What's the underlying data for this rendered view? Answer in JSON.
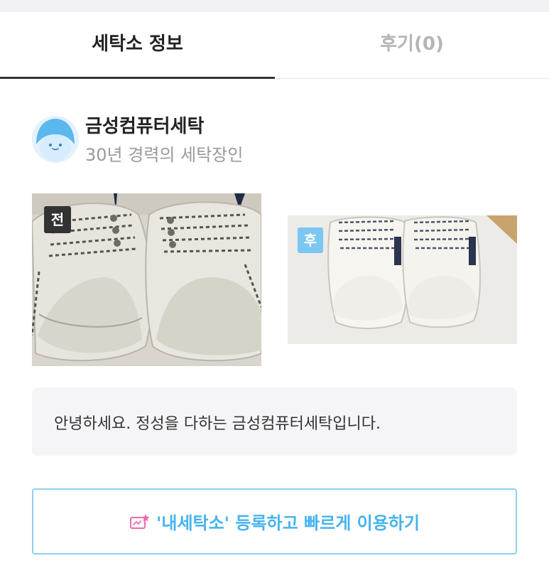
{
  "tabs": {
    "info": "세탁소 정보",
    "reviews": "후기(0)"
  },
  "shop": {
    "name": "금성컴퓨터세탁",
    "tagline": "30년 경력의 세탁장인",
    "avatar_icon": "smiling-face-icon"
  },
  "photos": {
    "before_label": "전",
    "after_label": "후"
  },
  "greeting": "안녕하세요. 정성을 다하는 금성컴퓨터세탁입니다.",
  "register_button": {
    "label": "'내세탁소' 등록하고 빠르게 이용하기",
    "icon": "star-card-icon"
  },
  "colors": {
    "accent": "#45b3ee",
    "accent_border": "#8ed0f3",
    "icon_pink": "#f06aa9",
    "inactive_tab": "#b5b5b5"
  }
}
